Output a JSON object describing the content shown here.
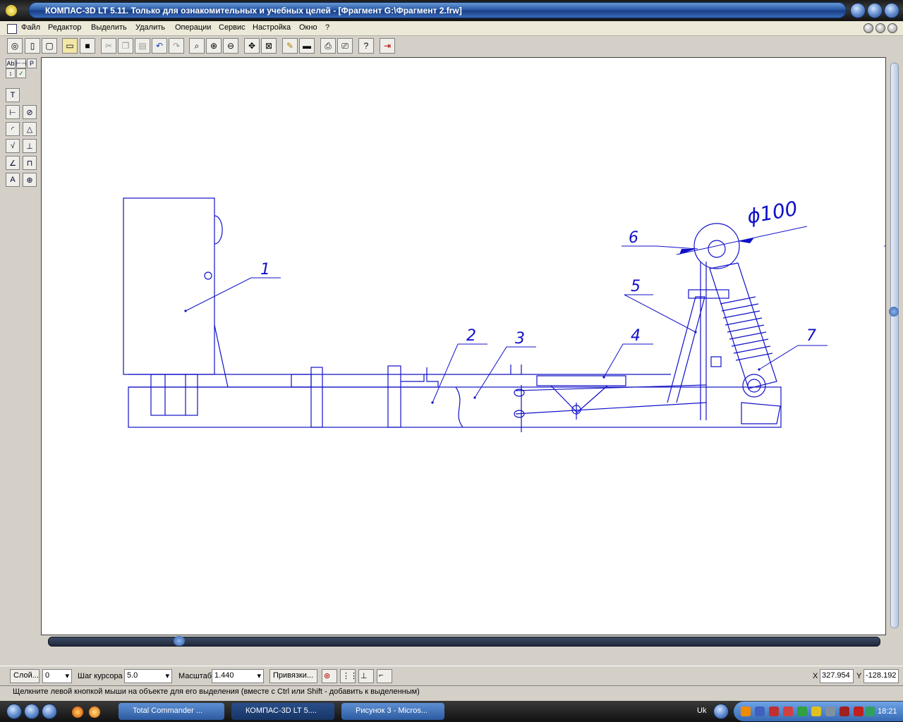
{
  "window": {
    "title": "КОМПАС-3D LT 5.11. Только для ознакомительных и учебных целей - [Фрагмент G:\\Фрагмент 2.frw]"
  },
  "menu": [
    "Файл",
    "Редактор",
    "Выделить",
    "Удалить",
    "Операции",
    "Сервис",
    "Настройка",
    "Окно",
    "?"
  ],
  "toolbar": {
    "icons": [
      "view-icon",
      "new-sheet-icon",
      "new-document-icon",
      "open-icon",
      "save-icon",
      "cut-icon",
      "copy-icon",
      "paste-icon",
      "undo-icon",
      "redo-icon",
      "zoom-icon",
      "zoom-in-icon",
      "zoom-out-icon",
      "pan-icon",
      "zoom-fit-icon",
      "properties-icon",
      "preview-icon",
      "print-preview-icon",
      "print-icon",
      "help-icon",
      "exit-icon"
    ]
  },
  "left_palette": {
    "top_tabs": [
      "Ab",
      "⊢⊣",
      "P"
    ]
  },
  "drawing": {
    "labels": [
      "1",
      "2",
      "3",
      "4",
      "5",
      "6",
      "7"
    ],
    "dimension": "ϕ100"
  },
  "status": {
    "layer_label": "Слой...",
    "layer_value": "0",
    "step_label": "Шаг курсора",
    "step_value": "5.0",
    "scale_label": "Масштаб",
    "scale_value": "1.440",
    "snaps_label": "Привязки...",
    "x_label": "X",
    "x_value": "327.954",
    "y_label": "Y",
    "y_value": "-128.192",
    "hint": "Щелкните левой кнопкой мыши на объекте для его выделения (вместе с Ctrl или Shift - добавить к выделенным)"
  },
  "taskbar": {
    "items": [
      {
        "label": "Total Commander ...",
        "active": false
      },
      {
        "label": "КОМПАС-3D LT 5....",
        "active": true
      },
      {
        "label": "Рисунок 3 - Micros...",
        "active": false
      }
    ],
    "lang": "Uk",
    "time": "18:21"
  }
}
